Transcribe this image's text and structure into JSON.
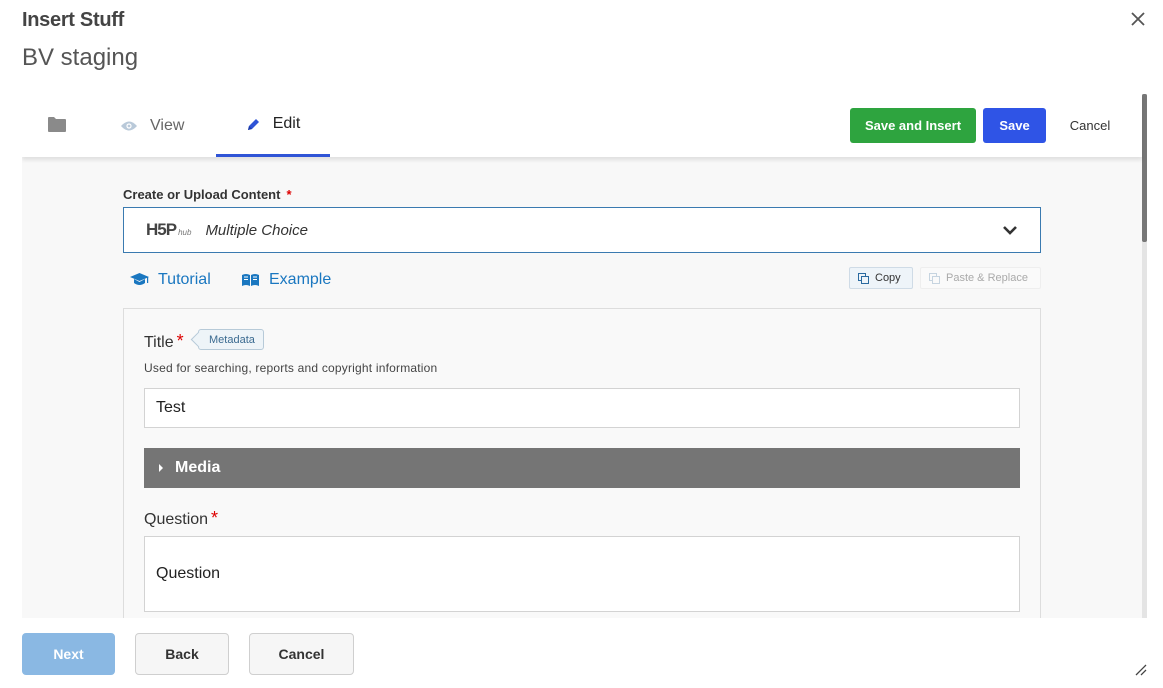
{
  "dialog": {
    "title": "Insert Stuff",
    "subtitle": "BV staging",
    "close_icon": "close-icon"
  },
  "tabs": {
    "folder_icon": "folder-icon",
    "view_label": "View",
    "view_icon": "eye-icon",
    "edit_label": "Edit",
    "edit_icon": "pencil-icon",
    "active": "Edit"
  },
  "toolbar": {
    "save_insert_label": "Save and Insert",
    "save_label": "Save",
    "cancel_label": "Cancel"
  },
  "content": {
    "label": "Create or Upload Content",
    "required_mark": "*",
    "logo_text": "H5P",
    "logo_sub": "hub",
    "selected_type": "Multiple Choice",
    "tutorial_label": "Tutorial",
    "example_label": "Example",
    "copy_label": "Copy",
    "paste_label": "Paste & Replace"
  },
  "form": {
    "title_label": "Title",
    "title_required": "*",
    "metadata_label": "Metadata",
    "title_help": "Used for searching, reports and copyright information",
    "title_value": "Test",
    "media_label": "Media",
    "question_label": "Question",
    "question_required": "*",
    "question_value": "Question"
  },
  "footer": {
    "next_label": "Next",
    "back_label": "Back",
    "cancel_label": "Cancel"
  },
  "colors": {
    "save_insert": "#2ea43f",
    "save": "#2f54e6",
    "active_tab": "#2f54d6",
    "link": "#1a77c0",
    "media_bar": "#757575",
    "next_button": "#8ab8e3"
  }
}
